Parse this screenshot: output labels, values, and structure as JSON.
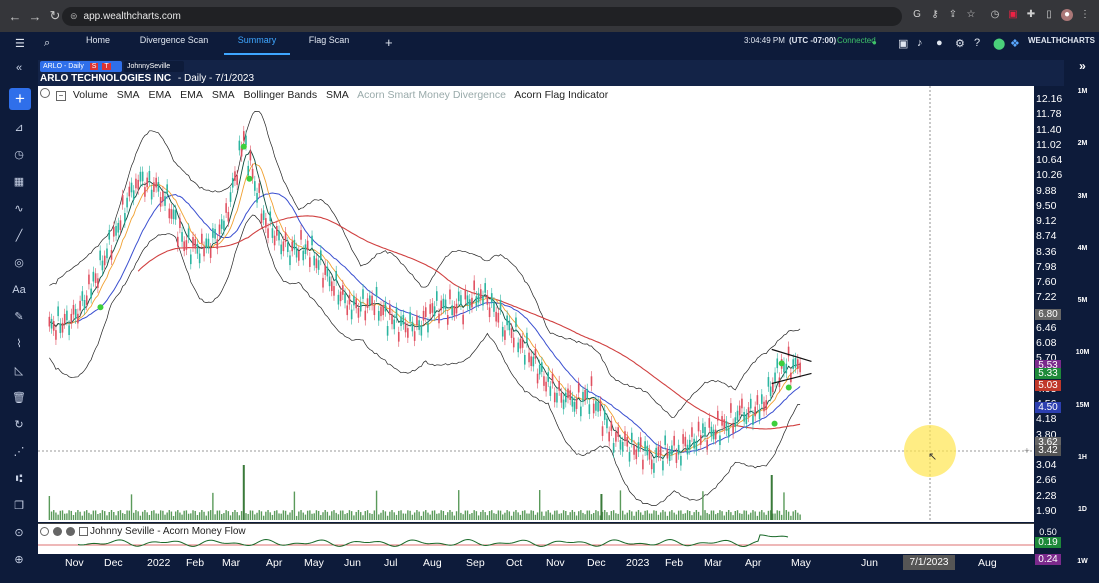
{
  "browser": {
    "url": "app.wealthcharts.com"
  },
  "nav": {
    "tabs": [
      "Home",
      "Divergence Scan",
      "Summary",
      "Flag Scan"
    ],
    "active_tab": "Summary",
    "time": "3:04:49 PM",
    "timezone": "(UTC -07:00)",
    "connection": "Connected",
    "brand": "WEALTHCHARTS"
  },
  "chart_header": {
    "ticker_pill": "ARLO - Daily",
    "pill_badges": [
      "S",
      "T"
    ],
    "user_pill": "JohnnySeville",
    "title": "ARLO TECHNOLOGIES INC",
    "subtitle": "- Daily - 7/1/2023"
  },
  "indicators": [
    {
      "name": "Volume",
      "enabled": true
    },
    {
      "name": "SMA",
      "enabled": true
    },
    {
      "name": "EMA",
      "enabled": true
    },
    {
      "name": "EMA",
      "enabled": true
    },
    {
      "name": "SMA",
      "enabled": true
    },
    {
      "name": "Bollinger Bands",
      "enabled": true
    },
    {
      "name": "SMA",
      "enabled": true
    },
    {
      "name": "Acorn Smart Money Divergence",
      "enabled": false
    },
    {
      "name": "Acorn Flag Indicator",
      "enabled": true
    }
  ],
  "oscillator": {
    "label": "Johnny Seville - Acorn Money Flow",
    "values": [
      "0.19",
      "0.24"
    ],
    "axis_top": "0.50"
  },
  "price_axis": [
    "12.16",
    "11.78",
    "11.40",
    "11.02",
    "10.64",
    "10.26",
    "9.88",
    "9.50",
    "9.12",
    "8.74",
    "8.36",
    "7.98",
    "7.60",
    "7.22",
    "6.84",
    "6.46",
    "6.08",
    "5.70",
    "5.31",
    "4.93",
    "4.56",
    "4.18",
    "3.80",
    "3.42",
    "3.04",
    "2.66",
    "2.28",
    "1.90"
  ],
  "price_badges": [
    {
      "value": "6.80",
      "color": "#666666"
    },
    {
      "value": "5.53",
      "color": "#7b2a8c"
    },
    {
      "value": "5.33",
      "color": "#1e8a3a"
    },
    {
      "value": "5.03",
      "color": "#c0392b"
    },
    {
      "value": "4.50",
      "color": "#2c3fb0"
    },
    {
      "value": "3.62",
      "color": "#666666"
    },
    {
      "value": "3.42",
      "color": "#555555"
    }
  ],
  "time_axis": [
    "Nov",
    "Dec",
    "2022",
    "Feb",
    "Mar",
    "Apr",
    "May",
    "Jun",
    "Jul",
    "Aug",
    "Sep",
    "Oct",
    "Nov",
    "Dec",
    "2023",
    "Feb",
    "Mar",
    "Apr",
    "May",
    "Jun",
    "Aug"
  ],
  "cursor_date": "7/1/2023",
  "timeframes": [
    "1M",
    "2M",
    "3M",
    "4M",
    "5M",
    "10M",
    "15M",
    "1H",
    "1D",
    "1W"
  ],
  "chart_data": {
    "type": "line",
    "title": "ARLO TECHNOLOGIES INC - Daily - 7/1/2023",
    "ylim": [
      1.9,
      12.16
    ],
    "x": [
      "2021-10-15",
      "2021-11-01",
      "2021-11-15",
      "2021-12-01",
      "2021-12-15",
      "2022-01-03",
      "2022-01-18",
      "2022-02-01",
      "2022-02-15",
      "2022-03-01",
      "2022-03-15",
      "2022-04-01",
      "2022-04-15",
      "2022-05-02",
      "2022-05-16",
      "2022-06-01",
      "2022-06-15",
      "2022-07-01",
      "2022-07-15",
      "2022-08-01",
      "2022-08-15",
      "2022-09-01",
      "2022-09-15",
      "2022-10-03",
      "2022-10-17",
      "2022-11-01",
      "2022-11-15",
      "2022-12-01",
      "2022-12-15",
      "2023-01-03",
      "2023-01-17",
      "2023-02-01",
      "2023-02-15",
      "2023-03-01",
      "2023-03-15",
      "2023-03-28"
    ],
    "series": [
      {
        "values": [
          6.5,
          6.7,
          7.6,
          8.9,
          10.2,
          9.9,
          8.6,
          8.4,
          9.0,
          11.2,
          9.2,
          8.4,
          8.5,
          7.6,
          7.0,
          7.1,
          6.6,
          6.5,
          7.0,
          7.0,
          7.4,
          6.6,
          6.0,
          5.0,
          4.6,
          4.8,
          3.8,
          3.5,
          3.3,
          3.5,
          3.8,
          4.0,
          4.3,
          4.5,
          5.6,
          5.5
        ]
      }
    ]
  }
}
